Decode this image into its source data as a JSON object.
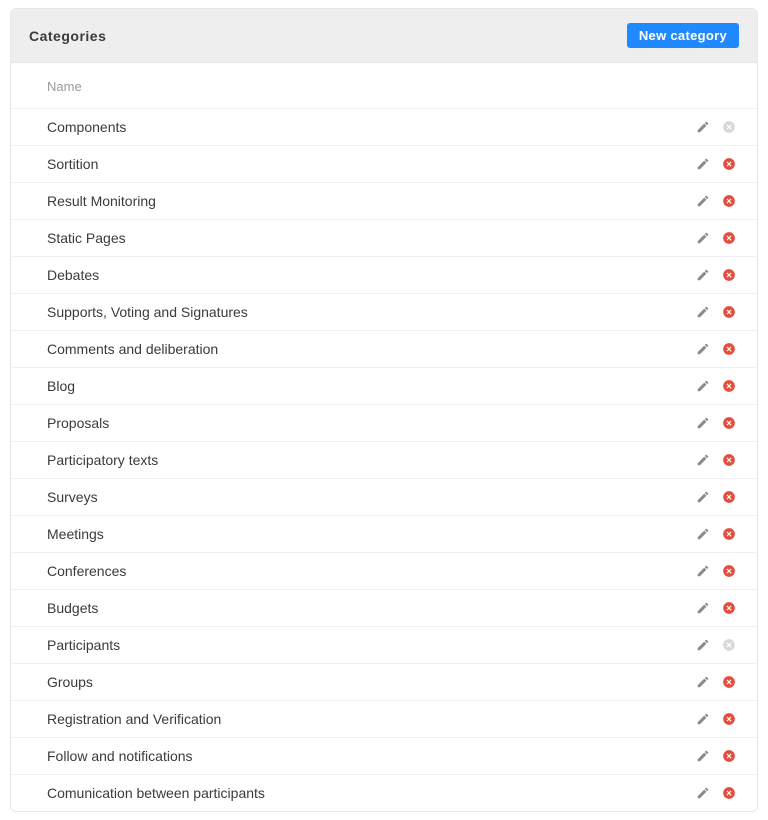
{
  "panel": {
    "title": "Categories",
    "new_button_label": "New category"
  },
  "table": {
    "header_name": "Name",
    "rows": [
      {
        "name": "Components",
        "deletable": false
      },
      {
        "name": "Sortition",
        "deletable": true
      },
      {
        "name": "Result Monitoring",
        "deletable": true
      },
      {
        "name": "Static Pages",
        "deletable": true
      },
      {
        "name": "Debates",
        "deletable": true
      },
      {
        "name": "Supports, Voting and Signatures",
        "deletable": true
      },
      {
        "name": "Comments and deliberation",
        "deletable": true
      },
      {
        "name": "Blog",
        "deletable": true
      },
      {
        "name": "Proposals",
        "deletable": true
      },
      {
        "name": "Participatory texts",
        "deletable": true
      },
      {
        "name": "Surveys",
        "deletable": true
      },
      {
        "name": "Meetings",
        "deletable": true
      },
      {
        "name": "Conferences",
        "deletable": true
      },
      {
        "name": "Budgets",
        "deletable": true
      },
      {
        "name": "Participants",
        "deletable": false
      },
      {
        "name": "Groups",
        "deletable": true
      },
      {
        "name": "Registration and Verification",
        "deletable": true
      },
      {
        "name": "Follow and notifications",
        "deletable": true
      },
      {
        "name": "Comunication between participants",
        "deletable": true
      }
    ]
  }
}
